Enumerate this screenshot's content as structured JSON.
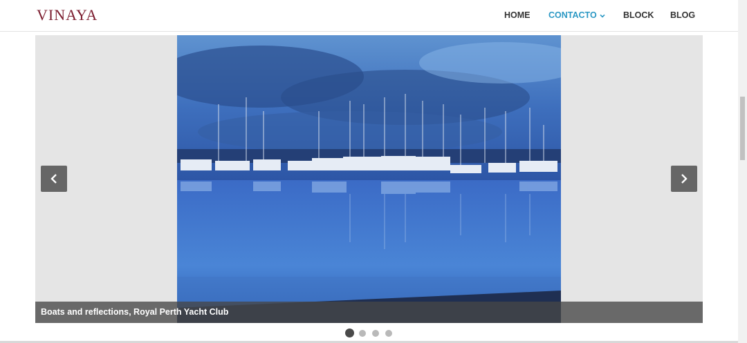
{
  "header": {
    "logo": "VINAYA",
    "nav": [
      {
        "label": "HOME",
        "active": false
      },
      {
        "label": "CONTACTO",
        "active": true,
        "dropdown": true
      },
      {
        "label": "BLOCK",
        "active": false
      },
      {
        "label": "BLOG",
        "active": false
      }
    ]
  },
  "slider": {
    "caption": "Boats and reflections, Royal Perth Yacht Club",
    "prev_icon": "chevron-left-icon",
    "next_icon": "chevron-right-icon",
    "slide_count": 4,
    "active_slide": 1
  },
  "colors": {
    "logo": "#7b1c2e",
    "nav_active": "#2b98c4",
    "nav_text": "#333333",
    "slider_bg": "#e5e5e5",
    "arrow_bg": "#666666"
  }
}
